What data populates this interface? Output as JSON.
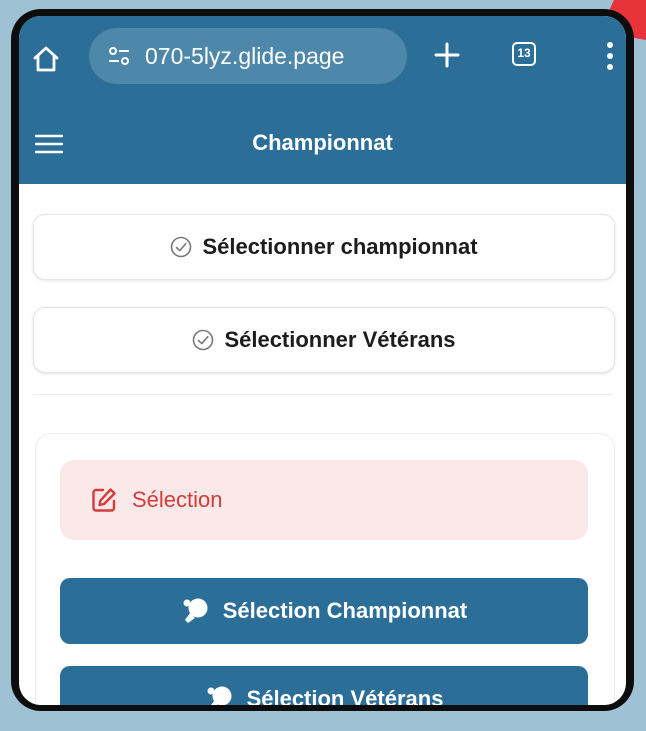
{
  "browser": {
    "url": "070-5lyz.glide.page",
    "tab_count": "13",
    "icons": [
      "home-icon",
      "site-settings-icon",
      "plus-icon",
      "tabs-icon",
      "more-vert-icon"
    ]
  },
  "header": {
    "title": "Championnat",
    "menu_icon": "hamburger-icon"
  },
  "buttons": {
    "select_championship": "Sélectionner championnat",
    "select_veterans": "Sélectionner Vétérans"
  },
  "card": {
    "alert_label": "Sélection",
    "selection_championship": "Sélection Championnat",
    "selection_veterans": "Sélection Vétérans"
  },
  "colors": {
    "primary": "#2b6f98",
    "alert_bg": "#fbe8e8",
    "alert_text": "#d63b3b"
  }
}
